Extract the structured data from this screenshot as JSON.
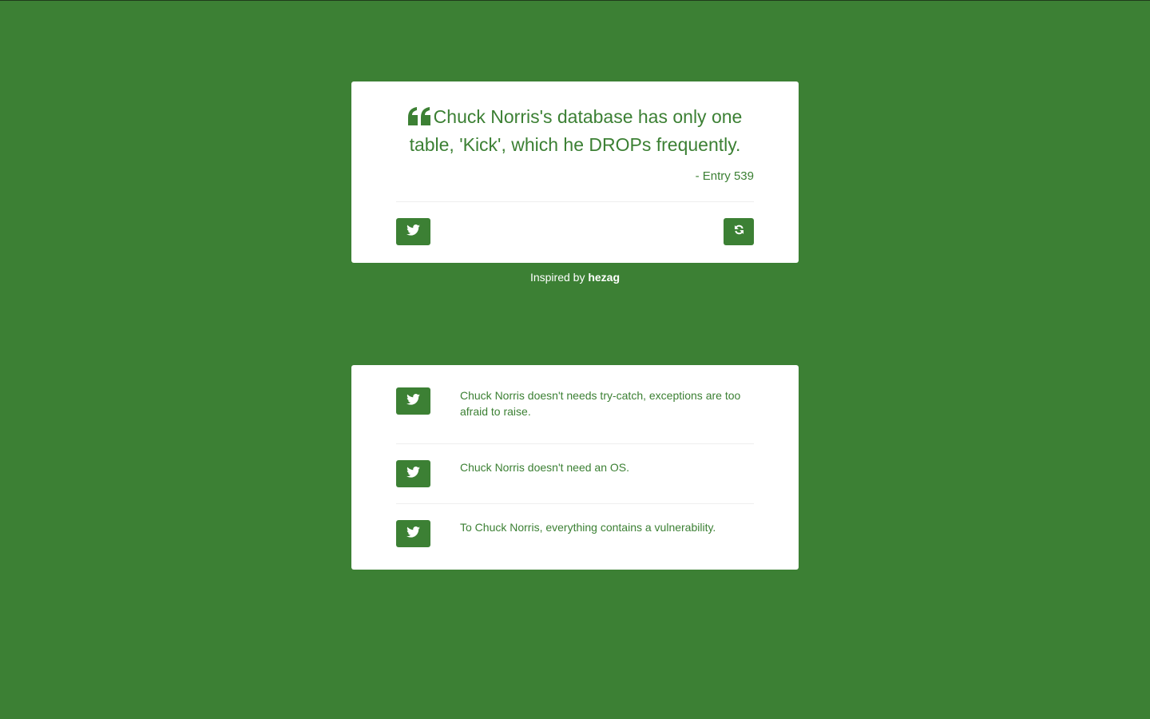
{
  "quote": {
    "text": "Chuck Norris's database has only one table, 'Kick', which he DROPs frequently.",
    "source": "- Entry 539",
    "tweet_icon": "twitter-icon",
    "refresh_icon": "refresh-icon",
    "quote_icon": "quote-left-icon"
  },
  "footer": {
    "prefix": "Inspired by",
    "author": "hezag"
  },
  "recent": [
    {
      "text": "Chuck Norris doesn't needs try-catch, exceptions are too afraid to raise.",
      "icon": "twitter-icon"
    },
    {
      "text": "Chuck Norris doesn't need an OS.",
      "icon": "twitter-icon"
    },
    {
      "text": "To Chuck Norris, everything contains a vulnerability.",
      "icon": "twitter-icon"
    }
  ],
  "colors": {
    "background": "#3c8034",
    "card": "#ffffff",
    "accent": "#3c8034",
    "divider": "#eeeeee"
  }
}
